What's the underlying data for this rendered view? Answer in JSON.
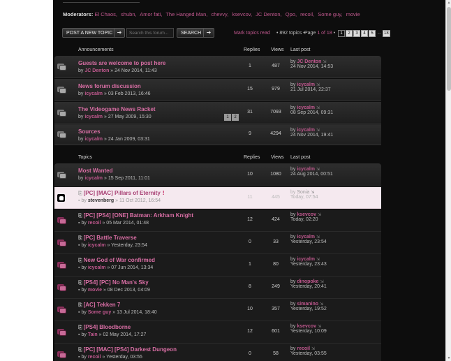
{
  "moderators": {
    "label": "Moderators:",
    "users": [
      "El Chaos,",
      "shubn,",
      "Amor fati,",
      "The Hanged Man,",
      "chevvy,",
      "ksevcov,",
      "JC Denton,",
      "Qpo,",
      "recoil,",
      "Some guy,",
      "movie"
    ]
  },
  "toolbar": {
    "new_topic": "POST A NEW TOPIC",
    "search_placeholder": "Search this forum...",
    "search_button": "SEARCH",
    "mark_read": "Mark topics read",
    "topic_count": "• 892 topics •",
    "page_prefix": "Page",
    "page_cur": "1 of 18",
    "pages": [
      "1",
      "2",
      "3",
      "4",
      "5",
      "...",
      "18"
    ]
  },
  "headers": {
    "announcements": "Announcements",
    "topics": "Topics",
    "replies": "Replies",
    "views": "Views",
    "last_post": "Last post"
  },
  "announcements": [
    {
      "title": "Guests are welcome to post here",
      "by": "by",
      "author": "JC Denton",
      "date": "» 24 Nov 2014, 11:43",
      "replies": "1",
      "views": "487",
      "last_by": "by",
      "last_user": "JC Denton",
      "last_date": "24 Nov 2014, 14:53"
    },
    {
      "title": "News forum discussion",
      "by": "by",
      "author": "icycalm",
      "date": "» 03 Feb 2013, 16:46",
      "replies": "15",
      "views": "979",
      "last_by": "by",
      "last_user": "icycalm",
      "last_date": "21 Jul 2014, 22:37"
    },
    {
      "title": "The Videogame News Racket",
      "by": "by",
      "author": "icycalm",
      "date": "» 27 May 2009, 15:30",
      "replies": "31",
      "views": "7093",
      "last_by": "by",
      "last_user": "icycalm",
      "last_date": "08 Sep 2014, 09:31",
      "pages": [
        "1",
        "2"
      ]
    },
    {
      "title": "Sources",
      "by": "by",
      "author": "icycalm",
      "date": "» 24 Jan 2009, 03:31",
      "replies": "9",
      "views": "4294",
      "last_by": "by",
      "last_user": "icycalm",
      "last_date": "24 Nov 2014, 19:41"
    }
  ],
  "topics": [
    {
      "title": "Most Wanted",
      "by": "by",
      "author": "icycalm",
      "date": "» 15 Sep 2011, 11:01",
      "replies": "10",
      "views": "1080",
      "last_by": "by",
      "last_user": "icycalm",
      "last_date": "24 Aug 2014, 00:51"
    },
    {
      "title": "[PC] [MAC] Pillars of Eternity",
      "excl": "!",
      "by": "by",
      "author": "stevenberg",
      "date": "» 11 Oct 2012, 16:54",
      "replies": "11",
      "views": "445",
      "last_by": "by",
      "last_user": "Sonia",
      "last_date": "Today, 07:54"
    },
    {
      "title": "[PC] [PS4] [ONE] Batman: Arkham Knight",
      "by": "by",
      "author": "recoil",
      "date": "» 05 Mar 2014, 01:48",
      "replies": "12",
      "views": "424",
      "last_by": "by",
      "last_user": "ksevcov",
      "last_date": "Today, 02:20"
    },
    {
      "title": "[PC] Battle Traverse",
      "by": "by",
      "author": "icycalm",
      "date": "» Yesterday, 23:54",
      "replies": "0",
      "views": "33",
      "last_by": "by",
      "last_user": "icycalm",
      "last_date": "Yesterday, 23:54"
    },
    {
      "title": "New God of War confirmed",
      "by": "by",
      "author": "icycalm",
      "date": "» 07 Jun 2014, 13:34",
      "replies": "1",
      "views": "80",
      "last_by": "by",
      "last_user": "icycalm",
      "last_date": "Yesterday, 23:43"
    },
    {
      "title": "[PS4] [PC] No Man's Sky",
      "by": "by",
      "author": "movie",
      "date": "» 08 Dec 2013, 04:09",
      "replies": "8",
      "views": "249",
      "last_by": "by",
      "last_user": "dinopoke",
      "last_date": "Yesterday, 20:41"
    },
    {
      "title": "[AC] Tekken 7",
      "by": "by",
      "author": "Some guy",
      "date": "» 13 Jul 2014, 18:40",
      "replies": "10",
      "views": "357",
      "last_by": "by",
      "last_user": "simanino",
      "last_date": "Yesterday, 19:52"
    },
    {
      "title": "[PS4] Bloodborne",
      "by": "by",
      "author": "Tain",
      "date": "» 02 May 2014, 17:27",
      "replies": "12",
      "views": "601",
      "last_by": "by",
      "last_user": "ksevcov",
      "last_date": "Yesterday, 10:09"
    },
    {
      "title": "[PC] [MAC] [PS4] Darkest Dungeon",
      "by": "by",
      "author": "recoil",
      "date": "» Yesterday, 03:55",
      "replies": "0",
      "views": "58",
      "last_by": "by",
      "last_user": "recoil",
      "last_date": "Yesterday, 03:55"
    }
  ]
}
